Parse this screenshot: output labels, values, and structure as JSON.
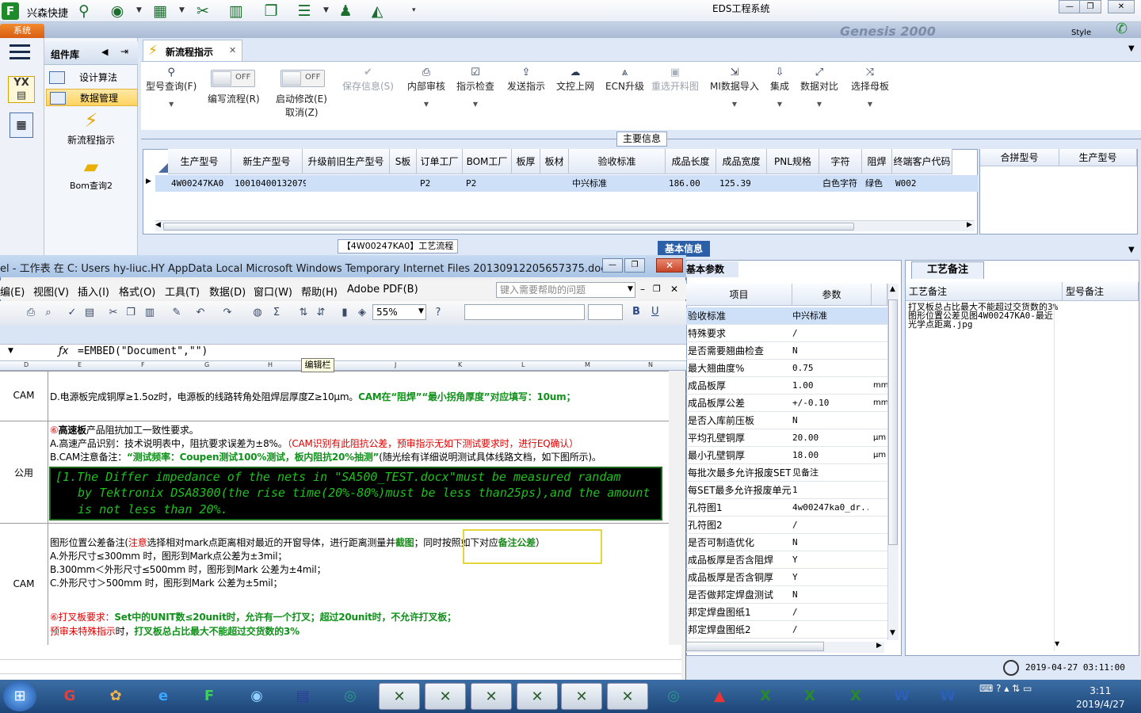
{
  "app": {
    "name": "兴森快捷",
    "window_title": "EDS工程系统",
    "system_tab": "系统",
    "style_label": "Style",
    "banner_text": "Genesis 2000"
  },
  "topbar_icons": [
    "search-icon",
    "globe-icon",
    "grid-icon",
    "cut-icon",
    "film-icon",
    "document-icon",
    "list-icon",
    "user-icon",
    "chart-icon"
  ],
  "leftnav": {
    "icons": [
      "menu-icon",
      "yx-icon",
      "calculator-icon"
    ]
  },
  "component_library": {
    "title": "组件库",
    "items": [
      {
        "label": "设计算法",
        "selected": false
      },
      {
        "label": "数据管理",
        "selected": true
      }
    ],
    "tools": [
      {
        "label": "新流程指示",
        "icon": "lightning-icon"
      },
      {
        "label": "Bom查询2",
        "icon": "folder-icon"
      }
    ]
  },
  "doc_tab": {
    "label": "新流程指示"
  },
  "ribbon": {
    "model_query": "型号查询(F)",
    "edit_flow": "编写流程(R)",
    "edit_flow_toggle": "OFF",
    "start_modify": "启动修改(E)",
    "start_modify_toggle": "OFF",
    "cancel": "取消(Z)",
    "save_info": "保存信息(S)",
    "internal_review": "内部审核",
    "check_instruction": "指示检查",
    "send_instruction": "发送指示",
    "doc_upload": "文控上网",
    "ecn_upgrade": "ECN升级",
    "reselect_material": "重选开料图",
    "mi_import": "MI数据导入",
    "integrate": "集成",
    "data_compare": "数据对比",
    "select_motherboard": "选择母板"
  },
  "main_info": {
    "label": "主要信息",
    "columns": [
      "生产型号",
      "新生产型号",
      "升级前旧生产型号",
      "S板",
      "订单工厂",
      "BOM工厂",
      "板厚",
      "板材",
      "验收标准",
      "成品长度",
      "成品宽度",
      "PNL规格",
      "字符",
      "阻焊",
      "终端客户代码"
    ],
    "row": [
      "4W00247KA0",
      "10010400132079",
      "",
      "",
      "P2",
      "P2",
      "",
      "",
      "中兴标准",
      "186.00",
      "125.39",
      "",
      "白色字符",
      "绿色",
      "W002"
    ],
    "right_columns": [
      "合拼型号",
      "生产型号"
    ]
  },
  "lower_tabs": {
    "flow_tab": "【4W00247KA0】工艺流程",
    "basic_tab": "基本信息"
  },
  "params": {
    "tab": "基本参数",
    "columns": [
      "项目",
      "参数"
    ],
    "rows": [
      {
        "item": "验收标准",
        "value": "中兴标准",
        "unit": ""
      },
      {
        "item": "特殊要求",
        "value": "/",
        "unit": ""
      },
      {
        "item": "是否需要翘曲检查",
        "value": "N",
        "unit": ""
      },
      {
        "item": "最大翘曲度%",
        "value": "0.75",
        "unit": ""
      },
      {
        "item": "成品板厚",
        "value": "1.00",
        "unit": "mm"
      },
      {
        "item": "成品板厚公差",
        "value": "+/-0.10",
        "unit": "mm"
      },
      {
        "item": "是否入库前压板",
        "value": "N",
        "unit": ""
      },
      {
        "item": "平均孔壁铜厚",
        "value": "20.00",
        "unit": "μm"
      },
      {
        "item": "最小孔壁铜厚",
        "value": "18.00",
        "unit": "μm"
      },
      {
        "item": "每批次最多允许报废SET",
        "value": "见备注",
        "unit": ""
      },
      {
        "item": "每SET最多允许报废单元",
        "value": "1",
        "unit": ""
      },
      {
        "item": "孔符图1",
        "value": "4w00247ka0_dr...",
        "unit": ""
      },
      {
        "item": "孔符图2",
        "value": "/",
        "unit": ""
      },
      {
        "item": "是否可制造优化",
        "value": "N",
        "unit": ""
      },
      {
        "item": "成品板厚是否含阻焊",
        "value": "Y",
        "unit": ""
      },
      {
        "item": "成品板厚是否含铜厚",
        "value": "Y",
        "unit": ""
      },
      {
        "item": "是否做邦定焊盘测试",
        "value": "N",
        "unit": ""
      },
      {
        "item": "邦定焊盘图纸1",
        "value": "/",
        "unit": ""
      },
      {
        "item": "邦定焊盘图纸2",
        "value": "/",
        "unit": ""
      }
    ]
  },
  "craft_notes": {
    "tab": "工艺备注",
    "columns": [
      "工艺备注",
      "型号备注"
    ],
    "text": "打叉板总占比最大不能超过交货数的3%  图形位置公差见图4W00247KA0-最近光学点距离.jpg"
  },
  "status": {
    "datetime": "2019-04-27 03:11:00"
  },
  "excel": {
    "title": "el - 工作表 在 C: Users hy-liuc.HY AppData Local Microsoft Windows Temporary Internet Files 20130912205657375.doc",
    "menus": [
      "编(E)",
      "视图(V)",
      "插入(I)",
      "格式(O)",
      "工具(T)",
      "数据(D)",
      "窗口(W)",
      "帮助(H)",
      "Adobe PDF(B)"
    ],
    "help_placeholder": "键入需要帮助的问题",
    "zoom": "55%",
    "formula": "=EMBED(\"Document\",\"\")",
    "tooltip": "编辑栏",
    "col_letters": [
      "D",
      "E",
      "F",
      "G",
      "H",
      "I",
      "J",
      "K",
      "L",
      "M",
      "N"
    ],
    "rows": {
      "r1_label": "CAM",
      "r1_text_a": "D.电源板完成铜厚≥1.5oz时，电源板的线路转角处阻焊层厚度Z≥10μm。",
      "r1_text_b": "CAM在“阻焊”“最小拐角厚度”对应填写：10um；",
      "r2_label": "公用",
      "r2_l1_a": "⑥",
      "r2_l1_b": "高速板",
      "r2_l1_c": "产品阻抗加工一致性要求。",
      "r2_l2_a": "A.高速产品识别：技术说明表中，阻抗要求误差为±8%。",
      "r2_l2_b": "（CAM识别有此阻抗公差，预审指示无如下测试要求时，进行EQ确认）",
      "r2_l3_a": "B.CAM注意备注：",
      "r2_l3_b": "“测试频率：Coupen测试100%测试，板内阻抗20%抽测”",
      "r2_l3_c": "(随光绘有详细说明测试具体线路文档，如下图所示)。",
      "r2_box_1": "[1.The Differ impedance of the nets in \"SA500_TEST.docx\"must be measured randam",
      "r2_box_2": "by Tektronix DSA8300(the rise time(20%-80%)must be less than25ps),and the amount",
      "r2_box_3": "is not less than 20%.",
      "r3_label": "CAM",
      "r3_l1_a": "图形位置公差备注(",
      "r3_l1_b": "注意",
      "r3_l1_c": "选择相对mark点距离相对最近的开窗导体，进行距离测量并",
      "r3_l1_d": "截图",
      "r3_l1_e": "；同时按照如下对应",
      "r3_l1_f": "备注公差",
      "r3_l1_g": "）",
      "r3_l2": "A.外形尺寸≤300mm 时，图形到Mark点公差为±3mil；",
      "r3_l3": "B.300mm＜外形尺寸≤500mm 时，图形到Mark 公差为±4mil；",
      "r3_l4": "C.外形尺寸＞500mm 时，图形到Mark 公差为±5mil；",
      "r3_l5_a": "⑥打叉板要求：",
      "r3_l5_b": "Set中的UNIT数≤20unit时，允许有一个打叉；超过20unit时，不允许打叉板；",
      "r3_l6_a": "预审未特殊指示",
      "r3_l6_b": "时，",
      "r3_l6_c": "打叉板总占比最大不能超过交货数的3%"
    }
  },
  "taskbar": {
    "time": "3:11",
    "date": "2019/4/27"
  }
}
